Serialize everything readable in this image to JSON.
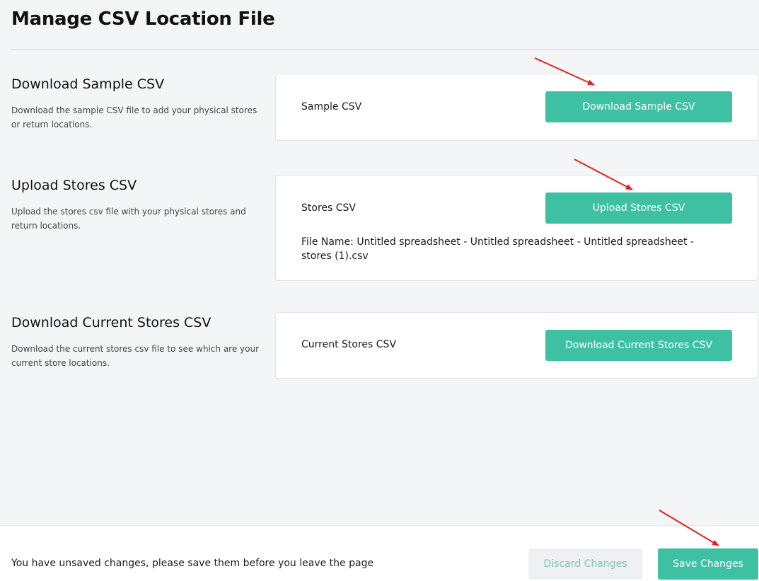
{
  "page": {
    "title": "Manage CSV Location File"
  },
  "sections": [
    {
      "heading": "Download Sample CSV",
      "description": "Download the sample CSV file to add your physical stores or return locations.",
      "card_label": "Sample CSV",
      "button_label": "Download Sample CSV"
    },
    {
      "heading": "Upload Stores CSV",
      "description": "Upload the stores csv file with your physical stores and return locations.",
      "card_label": "Stores CSV",
      "button_label": "Upload Stores CSV",
      "file_name": "File Name: Untitled spreadsheet - Untitled spreadsheet - Untitled spreadsheet - stores (1).csv"
    },
    {
      "heading": "Download Current Stores CSV",
      "description": "Download the current stores csv file to see which are your current store locations.",
      "card_label": "Current Stores CSV",
      "button_label": "Download Current Stores CSV"
    }
  ],
  "footer": {
    "message": "You have unsaved changes, please save them before you leave the page",
    "discard_label": "Discard Changes",
    "save_label": "Save Changes"
  },
  "colors": {
    "accent": "#3ec1a3",
    "annotation_arrow": "#e8201a"
  }
}
